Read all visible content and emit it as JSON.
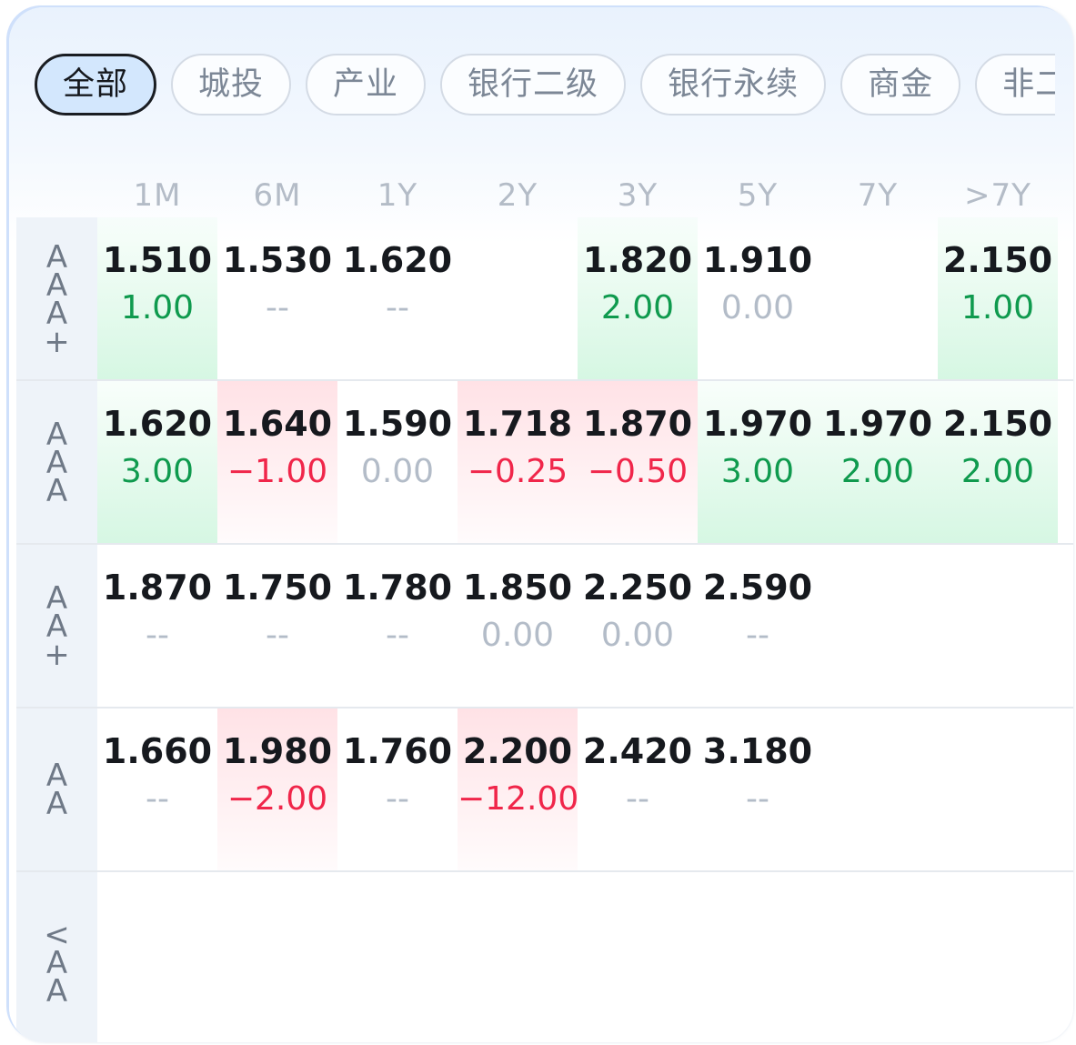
{
  "tabs": [
    "全部",
    "城投",
    "产业",
    "银行二级",
    "银行永续",
    "商金",
    "非二"
  ],
  "active_tab": "全部",
  "columns": [
    "1M",
    "6M",
    "1Y",
    "2Y",
    "3Y",
    "5Y",
    "7Y",
    ">7Y"
  ],
  "rows": [
    {
      "rating": [
        "A",
        "A",
        "A",
        "+"
      ],
      "cells": [
        {
          "value": "1.510",
          "change": "1.00",
          "trend": "up"
        },
        {
          "value": "1.530",
          "change": "--",
          "trend": "none"
        },
        {
          "value": "1.620",
          "change": "--",
          "trend": "none"
        },
        null,
        {
          "value": "1.820",
          "change": "2.00",
          "trend": "up"
        },
        {
          "value": "1.910",
          "change": "0.00",
          "trend": "flat"
        },
        null,
        {
          "value": "2.150",
          "change": "1.00",
          "trend": "up"
        }
      ]
    },
    {
      "rating": [
        "A",
        "A",
        "A"
      ],
      "cells": [
        {
          "value": "1.620",
          "change": "3.00",
          "trend": "up"
        },
        {
          "value": "1.640",
          "change": "−1.00",
          "trend": "down"
        },
        {
          "value": "1.590",
          "change": "0.00",
          "trend": "flat"
        },
        {
          "value": "1.718",
          "change": "−0.25",
          "trend": "down"
        },
        {
          "value": "1.870",
          "change": "−0.50",
          "trend": "down"
        },
        {
          "value": "1.970",
          "change": "3.00",
          "trend": "up"
        },
        {
          "value": "1.970",
          "change": "2.00",
          "trend": "up"
        },
        {
          "value": "2.150",
          "change": "2.00",
          "trend": "up"
        }
      ]
    },
    {
      "rating": [
        "A",
        "A",
        "+"
      ],
      "cells": [
        {
          "value": "1.870",
          "change": "--",
          "trend": "none"
        },
        {
          "value": "1.750",
          "change": "--",
          "trend": "none"
        },
        {
          "value": "1.780",
          "change": "--",
          "trend": "none"
        },
        {
          "value": "1.850",
          "change": "0.00",
          "trend": "flat"
        },
        {
          "value": "2.250",
          "change": "0.00",
          "trend": "flat"
        },
        {
          "value": "2.590",
          "change": "--",
          "trend": "none"
        },
        null,
        null
      ]
    },
    {
      "rating": [
        "A",
        "A"
      ],
      "cells": [
        {
          "value": "1.660",
          "change": "--",
          "trend": "none"
        },
        {
          "value": "1.980",
          "change": "−2.00",
          "trend": "down"
        },
        {
          "value": "1.760",
          "change": "--",
          "trend": "none"
        },
        {
          "value": "2.200",
          "change": "−12.00",
          "trend": "down"
        },
        {
          "value": "2.420",
          "change": "--",
          "trend": "none"
        },
        {
          "value": "3.180",
          "change": "--",
          "trend": "none"
        },
        null,
        null
      ]
    },
    {
      "rating": [
        "<",
        "A",
        "A"
      ],
      "cells": [
        null,
        null,
        null,
        null,
        null,
        null,
        null,
        null
      ]
    }
  ],
  "colors": {
    "up_text": "#0f9a4e",
    "down_text": "#f0264a",
    "flat_text": "#b3bcc8",
    "active_tab_bg": "#d3e7fd"
  }
}
